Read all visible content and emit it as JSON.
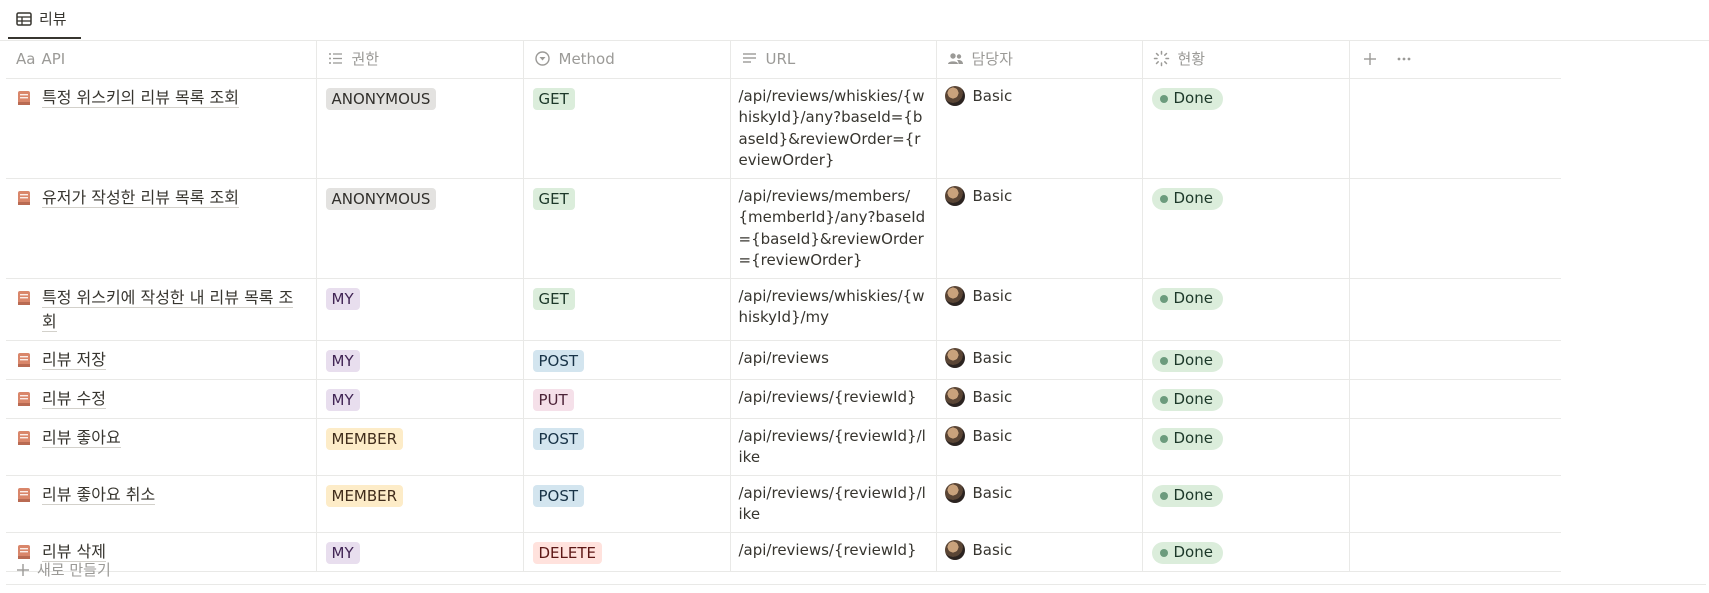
{
  "view_tab": {
    "label": "리뷰",
    "icon": "table-icon"
  },
  "columns": [
    {
      "key": "api",
      "label": "API",
      "prefix": "Aa"
    },
    {
      "key": "auth",
      "label": "권한",
      "icon": "list-icon"
    },
    {
      "key": "method",
      "label": "Method",
      "icon": "select-icon"
    },
    {
      "key": "url",
      "label": "URL",
      "icon": "text-lines-icon"
    },
    {
      "key": "owner",
      "label": "담당자",
      "icon": "people-icon"
    },
    {
      "key": "status",
      "label": "현황",
      "icon": "status-spinner-icon"
    }
  ],
  "rows": [
    {
      "api": "특정 위스키의 리뷰 목록 조회",
      "auth": "ANONYMOUS",
      "method": "GET",
      "url": "/api/reviews/whiskies/{whiskyId}/any?baseId={baseId}&reviewOrder={reviewOrder}",
      "owner": "Basic",
      "status": "Done"
    },
    {
      "api": "유저가 작성한 리뷰 목록 조회",
      "auth": "ANONYMOUS",
      "method": "GET",
      "url": "/api/reviews/members/{memberId}/any?baseId={baseId}&reviewOrder={reviewOrder}",
      "owner": "Basic",
      "status": "Done"
    },
    {
      "api": "특정 위스키에 작성한 내 리뷰 목록 조회",
      "auth": "MY",
      "method": "GET",
      "url": "/api/reviews/whiskies/{whiskyId}/my",
      "owner": "Basic",
      "status": "Done"
    },
    {
      "api": "리뷰 저장",
      "auth": "MY",
      "method": "POST",
      "url": "/api/reviews",
      "owner": "Basic",
      "status": "Done"
    },
    {
      "api": "리뷰 수정",
      "auth": "MY",
      "method": "PUT",
      "url": "/api/reviews/{reviewId}",
      "owner": "Basic",
      "status": "Done"
    },
    {
      "api": "리뷰 좋아요",
      "auth": "MEMBER",
      "method": "POST",
      "url": "/api/reviews/{reviewId}/like",
      "owner": "Basic",
      "status": "Done"
    },
    {
      "api": "리뷰 좋아요 취소",
      "auth": "MEMBER",
      "method": "POST",
      "url": "/api/reviews/{reviewId}/like",
      "owner": "Basic",
      "status": "Done"
    },
    {
      "api": "리뷰 삭제",
      "auth": "MY",
      "method": "DELETE",
      "url": "/api/reviews/{reviewId}",
      "owner": "Basic",
      "status": "Done"
    }
  ],
  "new_row_label": "새로 만들기",
  "colors": {
    "auth": {
      "ANONYMOUS": "#e3e2e0",
      "MY": "#e8deee",
      "MEMBER": "#fdecc8"
    },
    "method": {
      "GET": "#dbeddb",
      "POST": "#d3e5ef",
      "PUT": "#f5e0e9",
      "DELETE": "#ffe2dd"
    },
    "status_done": "#dbeddb"
  }
}
